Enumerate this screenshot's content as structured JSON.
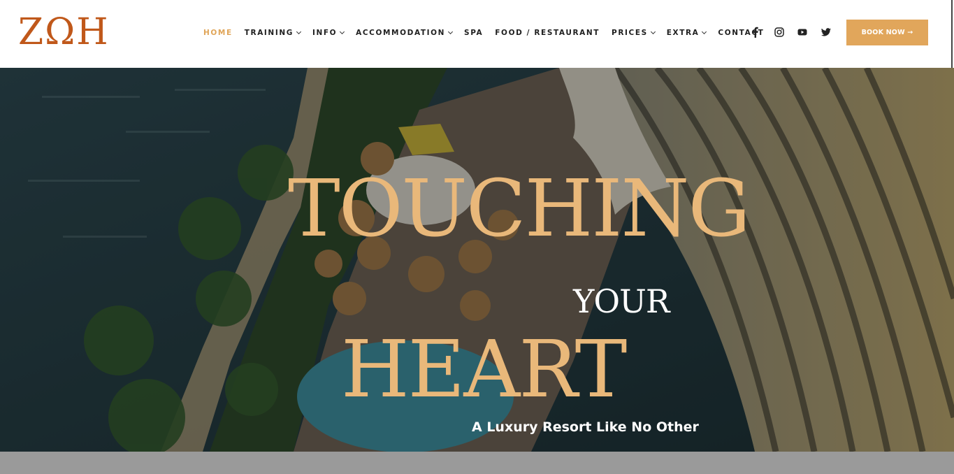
{
  "brand": {
    "logo_text": "ΖΩΗ",
    "accent": "#e1a65b",
    "logo_color": "#c0581a"
  },
  "nav": {
    "items": [
      {
        "label": "HOME",
        "active": true,
        "dropdown": false
      },
      {
        "label": "TRAINING",
        "active": false,
        "dropdown": true
      },
      {
        "label": "INFO",
        "active": false,
        "dropdown": true
      },
      {
        "label": "ACCOMMODATION",
        "active": false,
        "dropdown": true
      },
      {
        "label": "SPA",
        "active": false,
        "dropdown": false
      },
      {
        "label": "FOOD / RESTAURANT",
        "active": false,
        "dropdown": false
      },
      {
        "label": "PRICES",
        "active": false,
        "dropdown": true
      },
      {
        "label": "EXTRA",
        "active": false,
        "dropdown": true
      },
      {
        "label": "CONTACT",
        "active": false,
        "dropdown": false
      }
    ]
  },
  "social": [
    "facebook-icon",
    "instagram-icon",
    "youtube-icon",
    "twitter-icon"
  ],
  "header": {
    "book_label": "BOOK NOW →"
  },
  "hero": {
    "line1": "TOUCHING",
    "line2": "YOUR",
    "line3": "HEART",
    "subtitle": "A Luxury Resort Like No Other"
  }
}
